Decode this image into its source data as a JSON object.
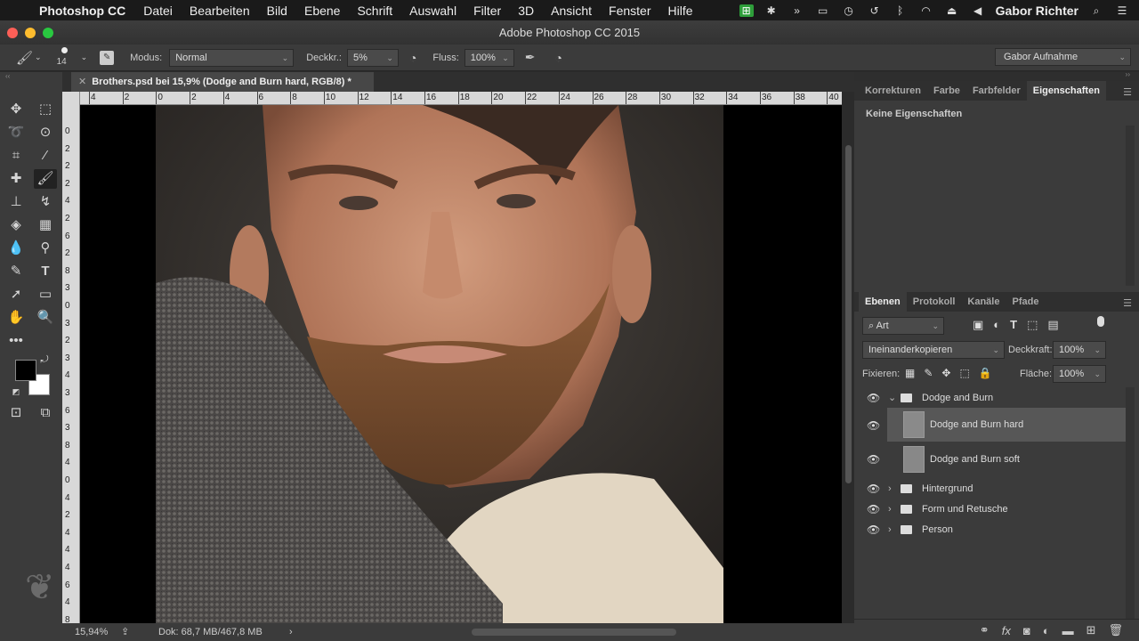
{
  "menubar": {
    "app": "Photoshop CC",
    "items": [
      "Datei",
      "Bearbeiten",
      "Bild",
      "Ebene",
      "Schrift",
      "Auswahl",
      "Filter",
      "3D",
      "Ansicht",
      "Fenster",
      "Hilfe"
    ],
    "user": "Gabor Richter"
  },
  "window": {
    "title": "Adobe Photoshop CC 2015"
  },
  "options": {
    "brush_size": "14",
    "mode_label": "Modus:",
    "mode_value": "Normal",
    "opacity_label": "Deckkr.:",
    "opacity_value": "5%",
    "flow_label": "Fluss:",
    "flow_value": "100%",
    "workspace": "Gabor Aufnahme"
  },
  "document": {
    "tab_title": "Brothers.psd bei 15,9% (Dodge and Burn hard, RGB/8) *",
    "zoom": "15,94%",
    "doc_info": "Dok: 68,7 MB/467,8 MB",
    "ruler_h": [
      "4",
      "2",
      "0",
      "2",
      "4",
      "6",
      "8",
      "10",
      "12",
      "14",
      "16",
      "18",
      "20",
      "22",
      "24",
      "26",
      "28",
      "30",
      "32",
      "34",
      "36",
      "38",
      "40"
    ],
    "ruler_v": [
      "0",
      "2",
      "2",
      "2",
      "4",
      "2",
      "6",
      "2",
      "8",
      "3",
      "0",
      "3",
      "2",
      "3",
      "4",
      "3",
      "6",
      "3",
      "8",
      "4",
      "0",
      "4",
      "2",
      "4",
      "4",
      "4",
      "6",
      "4",
      "8"
    ]
  },
  "properties_panel": {
    "tabs": [
      "Korrekturen",
      "Farbe",
      "Farbfelder",
      "Eigenschaften"
    ],
    "active_tab": "Eigenschaften",
    "empty_text": "Keine Eigenschaften"
  },
  "layers_panel": {
    "tabs": [
      "Ebenen",
      "Protokoll",
      "Kanäle",
      "Pfade"
    ],
    "active_tab": "Ebenen",
    "filter": "Art",
    "blend_mode": "Ineinanderkopieren",
    "opacity_label": "Deckkraft:",
    "opacity_value": "100%",
    "lock_label": "Fixieren:",
    "fill_label": "Fläche:",
    "fill_value": "100%",
    "layers": [
      {
        "name": "Dodge and Burn",
        "type": "group",
        "expanded": true
      },
      {
        "name": "Dodge and Burn hard",
        "type": "layer",
        "selected": true
      },
      {
        "name": "Dodge and Burn soft",
        "type": "layer"
      },
      {
        "name": "Hintergrund",
        "type": "group"
      },
      {
        "name": "Form und Retusche",
        "type": "group"
      },
      {
        "name": "Person",
        "type": "group"
      }
    ]
  },
  "colors": {
    "foreground": "#000000",
    "background": "#ffffff",
    "selected_layer": "#575757"
  }
}
